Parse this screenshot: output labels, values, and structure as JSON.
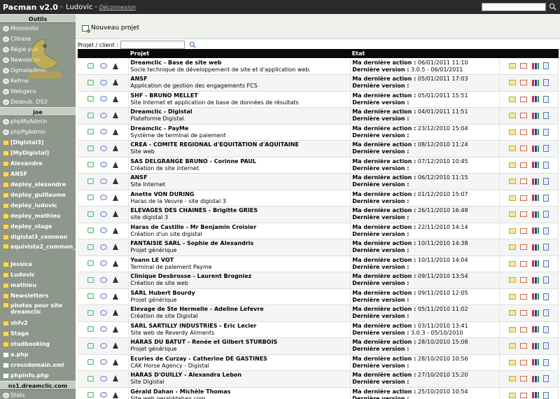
{
  "header": {
    "title": "Pacman v2.0",
    "user": "Ludovic",
    "separator": "-",
    "logout": "Déconnexion",
    "search_value": ""
  },
  "sidebar": {
    "sections": [
      {
        "title": "Outils",
        "items": [
          {
            "label": "Momonito",
            "icon": "gear-icon"
          },
          {
            "label": "Clibase",
            "icon": "gear-icon"
          },
          {
            "label": "Régie pub",
            "icon": "gear-icon"
          },
          {
            "label": "Newsletter",
            "icon": "gear-icon"
          },
          {
            "label": "Ogmaladmin",
            "icon": "gear-icon"
          },
          {
            "label": "Refme",
            "icon": "gear-icon"
          },
          {
            "label": "Webgeco",
            "icon": "gear-icon"
          },
          {
            "label": "Dedoub. DS3",
            "icon": "gear-icon"
          }
        ]
      },
      {
        "title": "joe",
        "items": [
          {
            "label": "phpMyAdmin",
            "icon": "gear-icon"
          },
          {
            "label": "phpPgAdmin",
            "icon": "gear-icon"
          },
          {
            "label": "[Digistal3]",
            "icon": "folder-icon"
          },
          {
            "label": "[MyDigistal]",
            "icon": "folder-icon"
          },
          {
            "label": "Alexandre",
            "icon": "folder-icon"
          },
          {
            "label": "ANSF",
            "icon": "folder-icon"
          },
          {
            "label": "deploy_alexandre",
            "icon": "folder-icon"
          },
          {
            "label": "deploy_guillaume",
            "icon": "folder-icon"
          },
          {
            "label": "deploy_ludovic",
            "icon": "folder-icon"
          },
          {
            "label": "deploy_mathieu",
            "icon": "folder-icon"
          },
          {
            "label": "deploy_stage",
            "icon": "folder-icon"
          },
          {
            "label": "digistal3_common",
            "icon": "folder-icon"
          },
          {
            "label": "equivista2_common_data",
            "icon": "folder-icon"
          },
          {
            "label": "Jessica",
            "icon": "folder-icon"
          },
          {
            "label": "Ludovic",
            "icon": "folder-icon"
          },
          {
            "label": "mathieu",
            "icon": "folder-icon"
          },
          {
            "label": "Newsletters",
            "icon": "folder-icon"
          },
          {
            "label": "photos pour site dreamclic",
            "icon": "folder-icon"
          },
          {
            "label": "shfv2",
            "icon": "folder-icon"
          },
          {
            "label": "Stage",
            "icon": "folder-icon"
          },
          {
            "label": "studbooking",
            "icon": "folder-icon"
          },
          {
            "label": "a.php",
            "icon": "file-icon"
          },
          {
            "label": "crossdomain.xml",
            "icon": "file-icon"
          },
          {
            "label": "phpinfo.php",
            "icon": "file-icon"
          }
        ]
      },
      {
        "title": "ns1.dreamclic.com",
        "items": [
          {
            "label": "Stats",
            "icon": "gear-icon"
          }
        ]
      }
    ]
  },
  "toolbar": {
    "new_project": "Nouveau projet"
  },
  "filter": {
    "label": "Projet / client :",
    "value": ""
  },
  "table": {
    "headers": [
      "",
      "Projet",
      "Etat",
      ""
    ],
    "last_action_label": "Ma dernière action :",
    "last_version_label": "Dernière version :",
    "rows": [
      {
        "name": "Dreamclic - Base de site web",
        "desc": "Socle technique de développement de site et d'application web.",
        "last_action": "06/01/2011 11:10",
        "last_version": "3.0.5 - 06/01/2011"
      },
      {
        "name": "ANSF",
        "desc": "Application de gestion des engagements FCS",
        "last_action": "05/01/2011 17:03",
        "last_version": ""
      },
      {
        "name": "SHF - BRUNO MELLET",
        "desc": "Site Internet et application de base de données de résultats",
        "last_action": "05/01/2011 15:51",
        "last_version": ""
      },
      {
        "name": "Dreamclic - Digistal",
        "desc": "Plateforme Digistal.",
        "last_action": "04/01/2011 11:51",
        "last_version": ""
      },
      {
        "name": "Dreamclic - PayMe",
        "desc": "Système de terminal de paiement",
        "last_action": "23/12/2010 15:04",
        "last_version": ""
      },
      {
        "name": "CREA - COMITE REGIONAL d'EQUITATION d'AQUITAINE",
        "desc": "Site web",
        "last_action": "08/12/2010 11:24",
        "last_version": ""
      },
      {
        "name": "SAS DELGRANGE BRUNO - Corinne PAUL",
        "desc": "Création de site internet.",
        "last_action": "07/12/2010 10:45",
        "last_version": ""
      },
      {
        "name": "ANSF",
        "desc": "Site Internet",
        "last_action": "06/12/2010 11:15",
        "last_version": ""
      },
      {
        "name": "Anette VON DURING",
        "desc": "Haras de la Vesvre - site digistal 3",
        "last_action": "01/12/2010 15:07",
        "last_version": ""
      },
      {
        "name": "ELEVAGES DES CHAINES - Brigitte GRIES",
        "desc": "site digistal 3",
        "last_action": "26/11/2010 16:48",
        "last_version": ""
      },
      {
        "name": "Haras de Castille - Mr Benjamin Croisier",
        "desc": "Création d'un site digistal",
        "last_action": "22/11/2010 14:14",
        "last_version": ""
      },
      {
        "name": "FANTAISIE SARL - Sophie de Alexandris",
        "desc": "Projet générique",
        "last_action": "10/11/2010 14:38",
        "last_version": ""
      },
      {
        "name": "Yoann LE VOT",
        "desc": "Terminal de paiement Payme",
        "last_action": "10/11/2010 14:04",
        "last_version": ""
      },
      {
        "name": "Clinique Desbrosse - Laurent Brogniez",
        "desc": "Création de site web",
        "last_action": "09/11/2010 13:54",
        "last_version": ""
      },
      {
        "name": "SARL Hubert Bourdy",
        "desc": "Projet générique",
        "last_action": "09/11/2010 12:05",
        "last_version": ""
      },
      {
        "name": "Elevage de Ste Hermelle - Adeline Lefevre",
        "desc": "Création de site Digistal",
        "last_action": "05/11/2010 11:02",
        "last_version": ""
      },
      {
        "name": "SARL SARTILLY INDUSTRIES - Eric Lecler",
        "desc": "Site web de Reverdy Aliments",
        "last_action": "03/11/2010 13:41",
        "last_version": "3.0.3 - 05/10/2010"
      },
      {
        "name": "HARAS DU BATUT - Renée et Gilbert STURBOIS",
        "desc": "Projet générique",
        "last_action": "28/10/2010 15:08",
        "last_version": ""
      },
      {
        "name": "Ecuries de Curzay - Catherine DE GASTINES",
        "desc": "CAK Horse Agency - Digistal",
        "last_action": "28/10/2010 10:56",
        "last_version": ""
      },
      {
        "name": "HARAS D'OUILLY - Alexandra Lebon",
        "desc": "Site Digistal",
        "last_action": "27/10/2010 15:20",
        "last_version": ""
      },
      {
        "name": "Gérald Dahan - Michèle Thomas",
        "desc": "Site web geralddahan.com",
        "last_action": "25/10/2010 10:54",
        "last_version": ""
      }
    ]
  }
}
